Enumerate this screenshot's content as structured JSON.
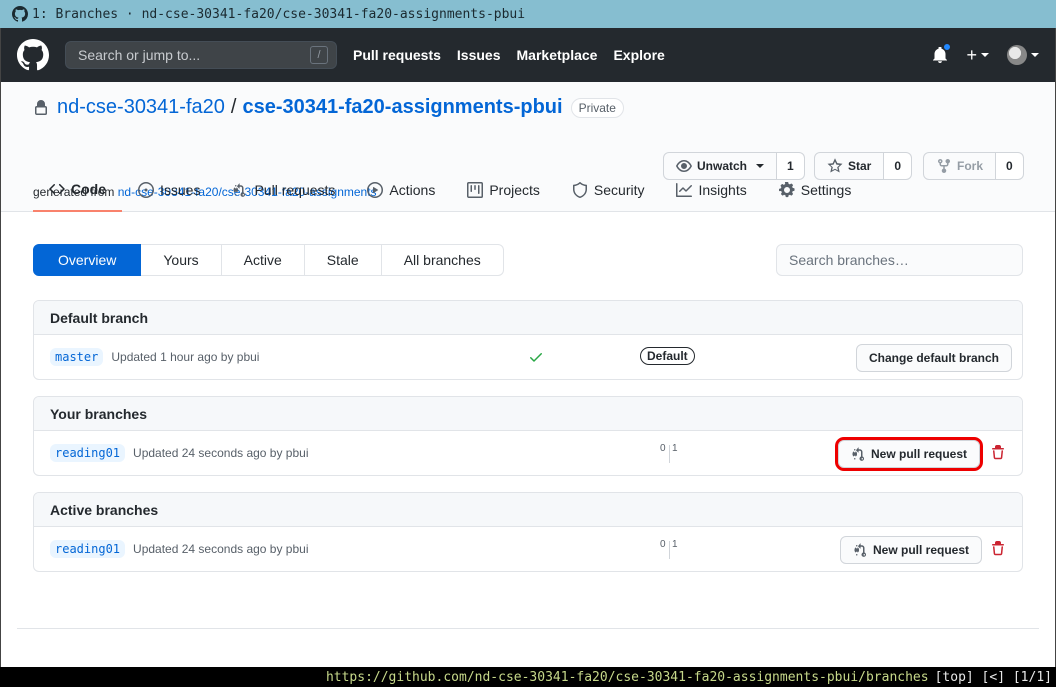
{
  "window": {
    "title": "1: Branches · nd-cse-30341-fa20/cse-30341-fa20-assignments-pbui"
  },
  "header": {
    "search_placeholder": "Search or jump to...",
    "search_key": "/",
    "nav": [
      "Pull requests",
      "Issues",
      "Marketplace",
      "Explore"
    ],
    "plus_label": "+"
  },
  "repo": {
    "owner": "nd-cse-30341-fa20",
    "separator": "/",
    "name": "cse-30341-fa20-assignments-pbui",
    "visibility": "Private",
    "generated_prefix": "generated from ",
    "generated_link": "nd-cse-30341-fa20/cse-30341-fa20-assignments",
    "unwatch": {
      "label": "Unwatch",
      "count": "1"
    },
    "star": {
      "label": "Star",
      "count": "0"
    },
    "fork": {
      "label": "Fork",
      "count": "0"
    }
  },
  "tabs": [
    {
      "label": "Code",
      "icon": "code-icon"
    },
    {
      "label": "Issues",
      "icon": "issue-icon"
    },
    {
      "label": "Pull requests",
      "icon": "pull-request-icon"
    },
    {
      "label": "Actions",
      "icon": "play-icon"
    },
    {
      "label": "Projects",
      "icon": "project-icon"
    },
    {
      "label": "Security",
      "icon": "shield-icon"
    },
    {
      "label": "Insights",
      "icon": "graph-icon"
    },
    {
      "label": "Settings",
      "icon": "gear-icon"
    }
  ],
  "subnav": [
    "Overview",
    "Yours",
    "Active",
    "Stale",
    "All branches"
  ],
  "branch_search_placeholder": "Search branches…",
  "sections": {
    "default": {
      "title": "Default branch",
      "branch": "master",
      "updated": "Updated 1 hour ago by pbui",
      "badge": "Default",
      "button": "Change default branch"
    },
    "yours": {
      "title": "Your branches",
      "branch": "reading01",
      "updated": "Updated 24 seconds ago by pbui",
      "behind": "0",
      "ahead": "1",
      "button": "New pull request"
    },
    "active": {
      "title": "Active branches",
      "branch": "reading01",
      "updated": "Updated 24 seconds ago by pbui",
      "behind": "0",
      "ahead": "1",
      "button": "New pull request"
    }
  },
  "statusbar": {
    "url": "https://github.com/nd-cse-30341-fa20/cse-30341-fa20-assignments-pbui/branches",
    "meta": "[top] [<] [1/1]"
  },
  "colors": {
    "accent": "#0366d6",
    "header_bg": "#24292e",
    "highlight": "#e00000",
    "tab_underline": "#f9826c"
  }
}
